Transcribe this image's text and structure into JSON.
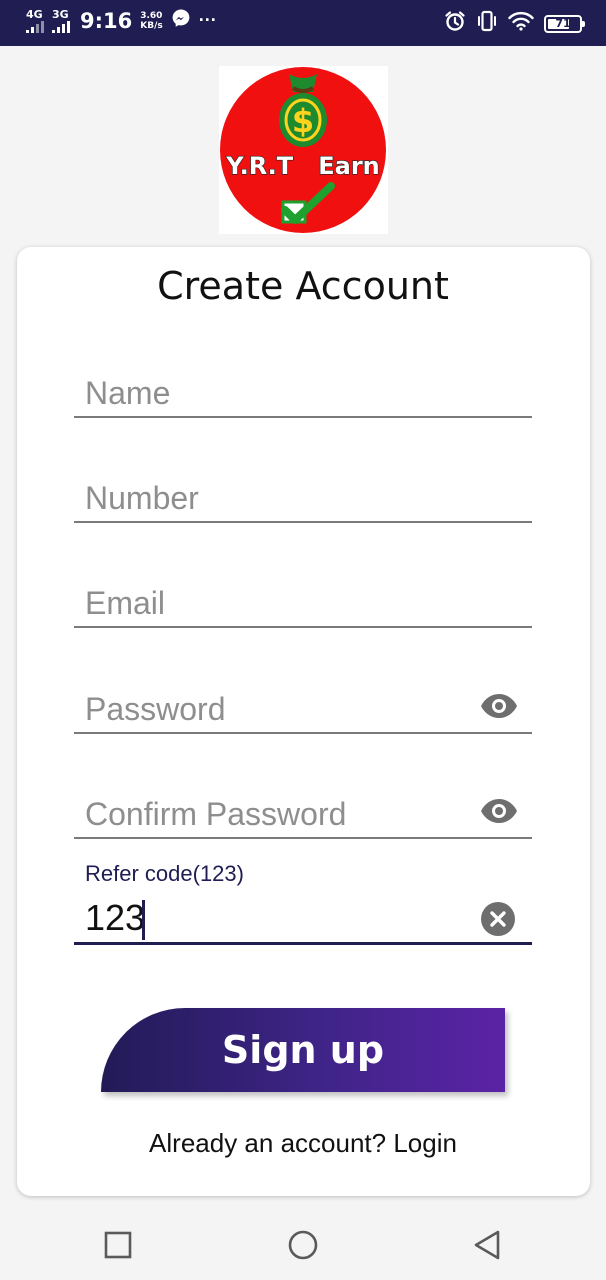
{
  "status_bar": {
    "network_1": "4G",
    "network_2": "3G",
    "time": "9:16",
    "speed_value": "3.60",
    "speed_unit": "KB/s",
    "more": "···",
    "battery_level": "71",
    "battery_fraction": 0.71,
    "icons": [
      "messenger-icon",
      "alarm-icon",
      "vibrate-icon",
      "wifi-icon",
      "battery-icon"
    ]
  },
  "logo": {
    "text": "Y.R.T   Earn",
    "bag_symbol": "$",
    "colors": {
      "circle": "#f01010",
      "bag": "#1e8a2e",
      "check": "#1ea12e"
    }
  },
  "form": {
    "title": "Create Account",
    "fields": [
      {
        "placeholder": "Name",
        "has_toggle": false
      },
      {
        "placeholder": "Number",
        "has_toggle": false
      },
      {
        "placeholder": "Email",
        "has_toggle": false
      },
      {
        "placeholder": "Password",
        "has_toggle": true
      },
      {
        "placeholder": "Confirm Password",
        "has_toggle": true
      }
    ],
    "refer": {
      "label": "Refer code(123)",
      "value": "123"
    },
    "signup_label": "Sign up",
    "login_text": "Already an account? Login"
  },
  "colors": {
    "status_bar_bg": "#1f1d52",
    "accent": "#1f1d52",
    "button_gradient_start": "#221b57",
    "button_gradient_end": "#5b23a6"
  },
  "nav": {
    "buttons": [
      "recents-square-icon",
      "home-circle-icon",
      "back-triangle-icon"
    ]
  }
}
